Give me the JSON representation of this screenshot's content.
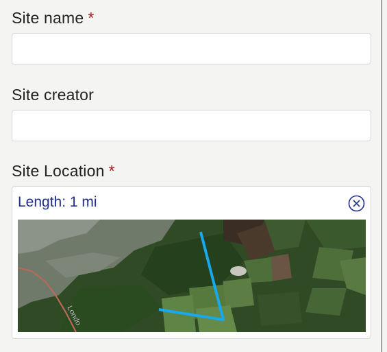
{
  "form": {
    "site_name": {
      "label": "Site name",
      "required_mark": "*",
      "value": ""
    },
    "site_creator": {
      "label": "Site creator",
      "value": ""
    },
    "site_location": {
      "label": "Site Location",
      "required_mark": "*",
      "length_text": "Length: 1 mi",
      "clear_icon": "circle-x-icon",
      "map": {
        "road_label": "Londo",
        "line_color": "#18a9ec"
      }
    }
  },
  "colors": {
    "required": "#a61c1c",
    "length_text": "#1f2d8a"
  }
}
